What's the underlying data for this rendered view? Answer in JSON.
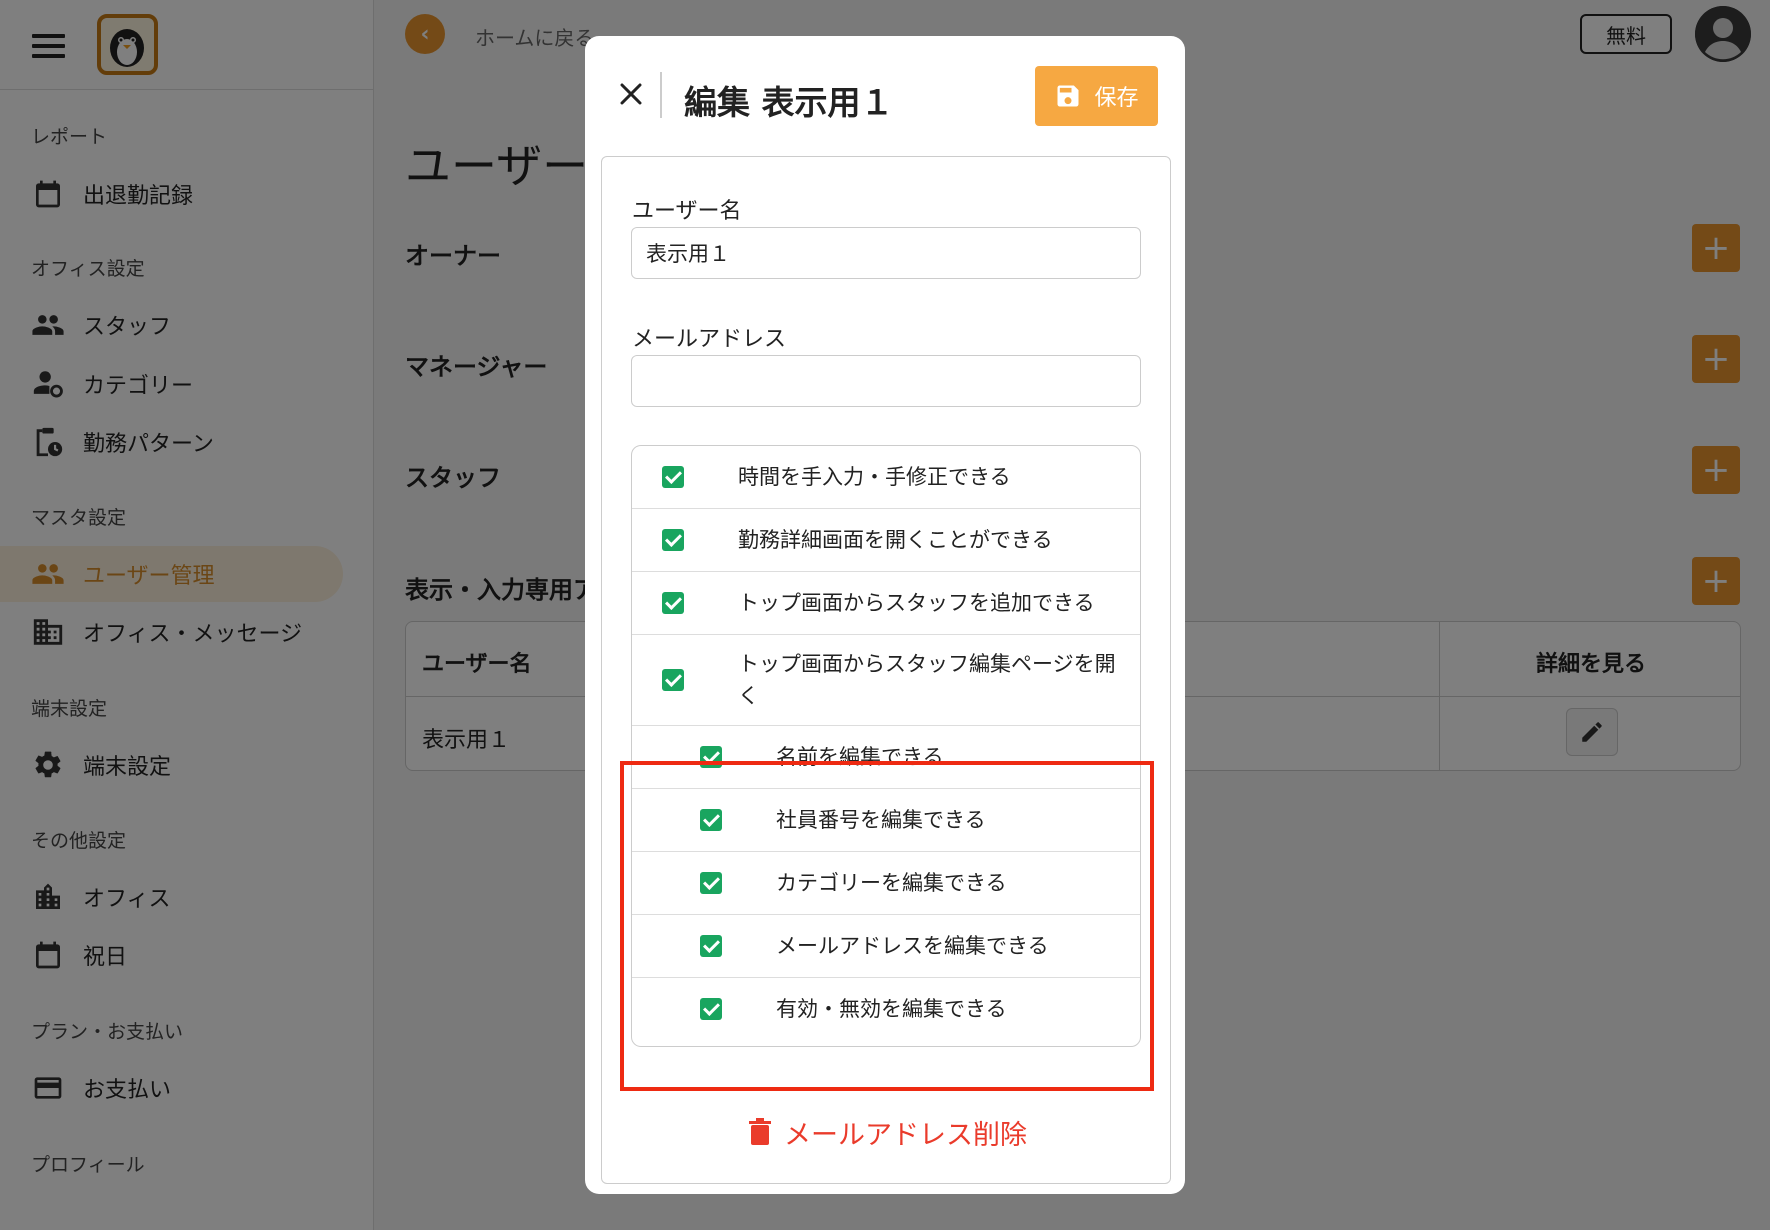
{
  "sidebar": {
    "sections": {
      "report": "レポート",
      "office": "オフィス設定",
      "master": "マスタ設定",
      "device": "端末設定",
      "other": "その他設定",
      "plan": "プラン・お支払い",
      "profile": "プロフィール"
    },
    "items": {
      "attendance": "出退勤記録",
      "staff": "スタッフ",
      "category": "カテゴリー",
      "work_pattern": "勤務パターン",
      "user_management": "ユーザー管理",
      "office_message": "オフィス・メッセージ",
      "device_settings": "端末設定",
      "office": "オフィス",
      "holiday": "祝日",
      "payment": "お支払い"
    }
  },
  "header": {
    "back_label": "ホームに戻る",
    "plan_badge": "無料"
  },
  "page": {
    "title": "ユーザー",
    "groups": {
      "owner": "オーナー",
      "manager": "マネージャー",
      "staff": "スタッフ",
      "display_input": "表示・入力専用ア"
    },
    "table": {
      "col_username": "ユーザー名",
      "col_detail": "詳細を見る",
      "row_username": "表示用１"
    }
  },
  "modal": {
    "title": "編集 表示用１",
    "save_label": "保存",
    "username_label": "ユーザー名",
    "username_value": "表示用１",
    "email_label": "メールアドレス",
    "email_value": "",
    "permissions": [
      "時間を手入力・手修正できる",
      "勤務詳細画面を開くことができる",
      "トップ画面からスタッフを追加できる",
      "トップ画面からスタッフ編集ページを開く",
      "名前を編集できる",
      "社員番号を編集できる",
      "カテゴリーを編集できる",
      "メールアドレスを編集できる",
      "有効・無効を編集できる"
    ],
    "delete_label": "メールアドレス削除"
  },
  "colors": {
    "accent": "#e8952e",
    "checkbox": "#19a55f",
    "highlight": "#ee2a12",
    "danger": "#ea3b2b"
  }
}
